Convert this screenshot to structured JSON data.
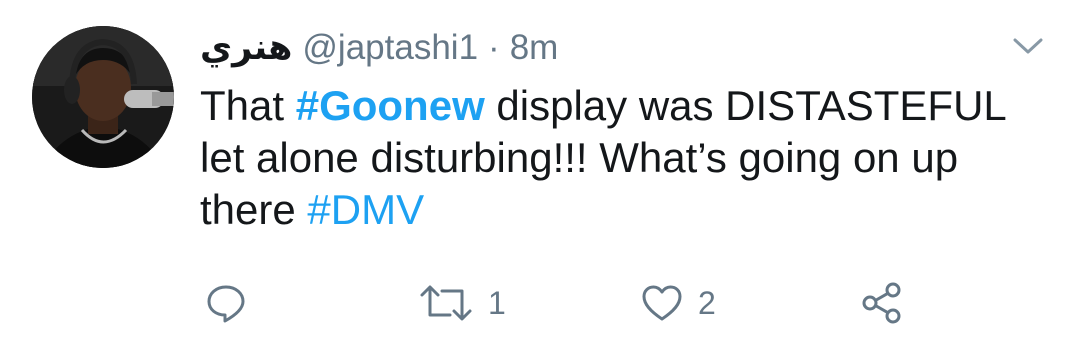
{
  "tweet": {
    "display_name": "هنري",
    "handle": "@japtashi1",
    "separator": "·",
    "time": "8m",
    "body": {
      "part1": "That ",
      "hashtag1": "#Goonew",
      "part2": " display was DISTASTEFUL let alone disturbing!!! What’s going on up there ",
      "hashtag2": "#DMV"
    },
    "retweet_count": "1",
    "like_count": "2"
  },
  "icons": {
    "reply": "reply-icon",
    "retweet": "retweet-icon",
    "like": "heart-icon",
    "share": "share-icon",
    "menu": "chevron-down-icon"
  },
  "colors": {
    "hashtag": "#1da1f2",
    "meta": "#657786",
    "text": "#14171a"
  }
}
